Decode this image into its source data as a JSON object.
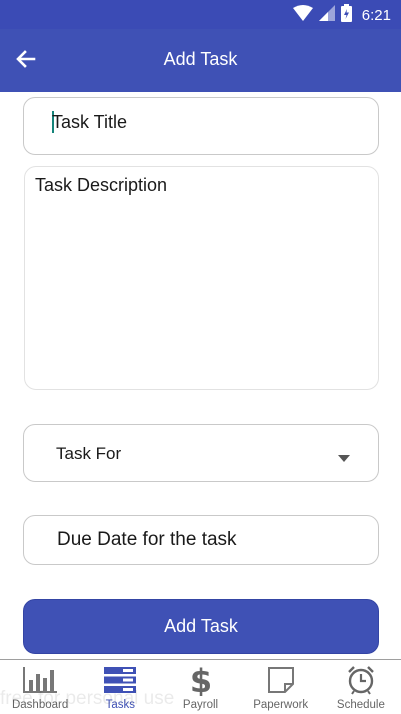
{
  "status_bar": {
    "time": "6:21"
  },
  "app_bar": {
    "title": "Add Task"
  },
  "form": {
    "title_placeholder": "Task Title",
    "description_placeholder": "Task Description",
    "task_for_label": "Task For",
    "due_date_placeholder": "Due Date for the task",
    "submit_label": "Add Task"
  },
  "bottom_nav": {
    "items": [
      {
        "label": "Dashboard",
        "icon": "bar-chart-icon"
      },
      {
        "label": "Tasks",
        "icon": "tasks-icon",
        "active": true
      },
      {
        "label": "Payroll",
        "icon": "dollar-icon"
      },
      {
        "label": "Paperwork",
        "icon": "document-icon"
      },
      {
        "label": "Schedule",
        "icon": "alarm-clock-icon"
      }
    ]
  },
  "watermark": "free for personal use",
  "colors": {
    "primary": "#3f51b5",
    "status_bar": "#3b4bb5",
    "cursor": "#15847a"
  }
}
